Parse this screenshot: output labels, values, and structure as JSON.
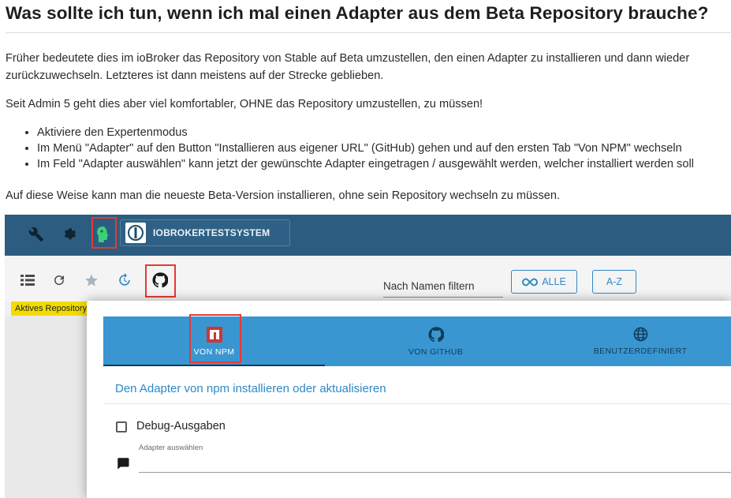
{
  "article": {
    "title": "Was sollte ich tun, wenn ich mal einen Adapter aus dem Beta Repository brauche?",
    "para1_line1": "Früher bedeutete dies im ioBroker das Repository von Stable auf Beta umzustellen, den einen Adapter zu installieren und dann wieder",
    "para1_line2": "zurückzuwechseln. Letzteres ist dann meistens auf der Strecke geblieben.",
    "para2": "Seit Admin 5 geht dies aber viel komfortabler, OHNE das Repository umzustellen, zu müssen!",
    "bullets": [
      "Aktiviere den Expertenmodus",
      "Im Menü \"Adapter\" auf den Button \"Installieren aus eigener URL\" (GitHub) gehen und auf den ersten Tab \"Von NPM\" wechseln",
      "Im Feld \"Adapter auswählen\" kann jetzt der gewünschte Adapter eingetragen / ausgewählt werden, welcher installiert werden soll"
    ],
    "para3": "Auf diese Weise kann man die neueste Beta-Version installieren, ohne sein Repository wechseln zu müssen."
  },
  "screenshot": {
    "host_name": "IOBROKERTESTSYSTEM",
    "filter_placeholder": "Nach Namen filtern",
    "btn_all": "ALLE",
    "btn_az": "A-Z",
    "repo_badge": "Aktives Repository",
    "tabs": [
      "VON NPM",
      "VON GITHUB",
      "BENUTZERDEFINIERT"
    ],
    "dialog_heading": "Den Adapter von npm installieren oder aktualisieren",
    "debug_label": "Debug-Ausgaben",
    "select_label": "Adapter auswählen",
    "colors": {
      "topbar": "#2c5d80",
      "tabbar": "#3a96d1",
      "accent": "#2f89c5",
      "highlight": "#e53935",
      "repo_badge": "#f2dc00",
      "npm_red": "#cb3837"
    }
  }
}
